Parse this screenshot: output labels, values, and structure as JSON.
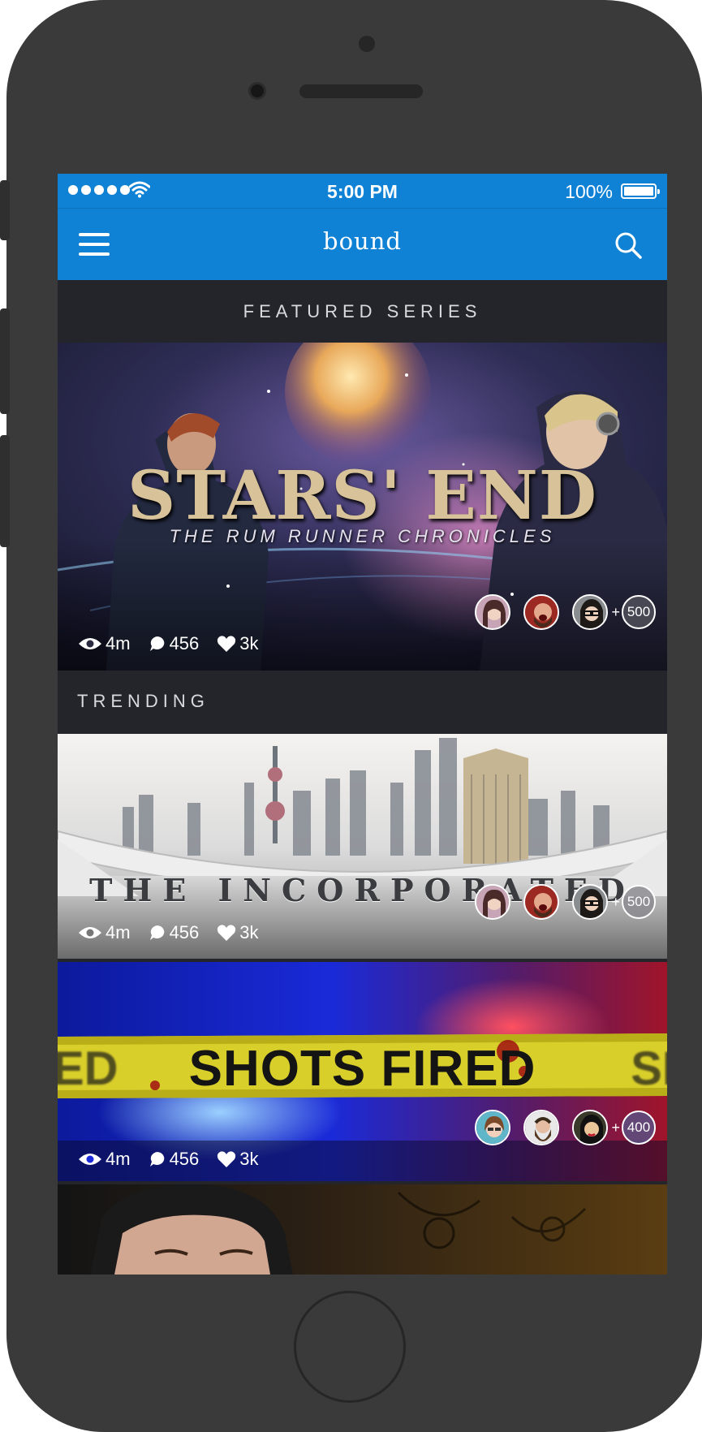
{
  "status_bar": {
    "time": "5:00 PM",
    "battery": "100%",
    "signal_icon": "signal-dots-icon",
    "wifi_icon": "wifi-icon"
  },
  "nav": {
    "title": "bound",
    "menu_icon": "hamburger-menu-icon",
    "search_icon": "search-icon"
  },
  "sections": {
    "featured": "FEATURED SERIES",
    "trending": "TRENDING"
  },
  "cards": [
    {
      "title": "STARS' END",
      "subtitle": "THE RUM RUNNER CHRONICLES",
      "views": "4m",
      "comments": "456",
      "likes": "3k",
      "plus_label": "+",
      "more_count": "500"
    },
    {
      "title": "THE INCORPORATED",
      "views": "4m",
      "comments": "456",
      "likes": "3k",
      "plus_label": "+",
      "more_count": "500"
    },
    {
      "title": "SHOTS FIRED",
      "tape_left": "ED",
      "tape_right": "SI",
      "views": "4m",
      "comments": "456",
      "likes": "3k",
      "plus_label": "+",
      "more_count": "400"
    }
  ],
  "colors": {
    "brand_blue": "#0f82d6",
    "background": "#23252b",
    "phone_shell": "#3a3a3a"
  }
}
